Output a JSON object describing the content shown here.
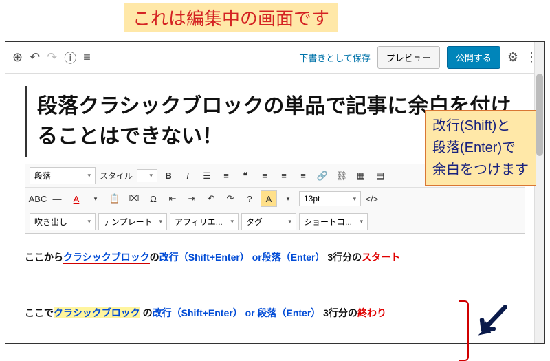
{
  "banner": "これは編集中の画面です",
  "annotation": {
    "line1": "改行(Shift)と",
    "line2": "段落(Enter)で",
    "line3": "余白をつけます"
  },
  "topbar": {
    "save_draft": "下書きとして保存",
    "preview": "プレビュー",
    "publish": "公開する"
  },
  "post_title": "段落クラシックブロックの単品で記事に余白を付けることはできない！",
  "tinymce": {
    "row1": {
      "format_select": "段落",
      "style_label": "スタイル"
    },
    "row2": {
      "font_size": "13pt"
    },
    "row3": {
      "callout": "吹き出し",
      "template": "テンプレート",
      "affiliate": "アフィリエ...",
      "tag": "タグ",
      "shortcode": "ショートコ..."
    }
  },
  "sample": {
    "line1_a": "ここから",
    "line1_b": "クラシックブロック",
    "line1_c": "の",
    "line1_d": "改行（Shift+Enter）",
    "line1_e": "or",
    "line1_f": "段落（Enter）",
    "line1_g": "3行分の",
    "line1_h": "スタート",
    "line2_a": "ここで",
    "line2_b": "クラシックブロック",
    "line2_c": " の",
    "line2_d": "改行（Shift+Enter）",
    "line2_e": "or",
    "line2_f": " 段落（Enter）",
    "line2_g": "3行分の",
    "line2_h": "終わり"
  }
}
